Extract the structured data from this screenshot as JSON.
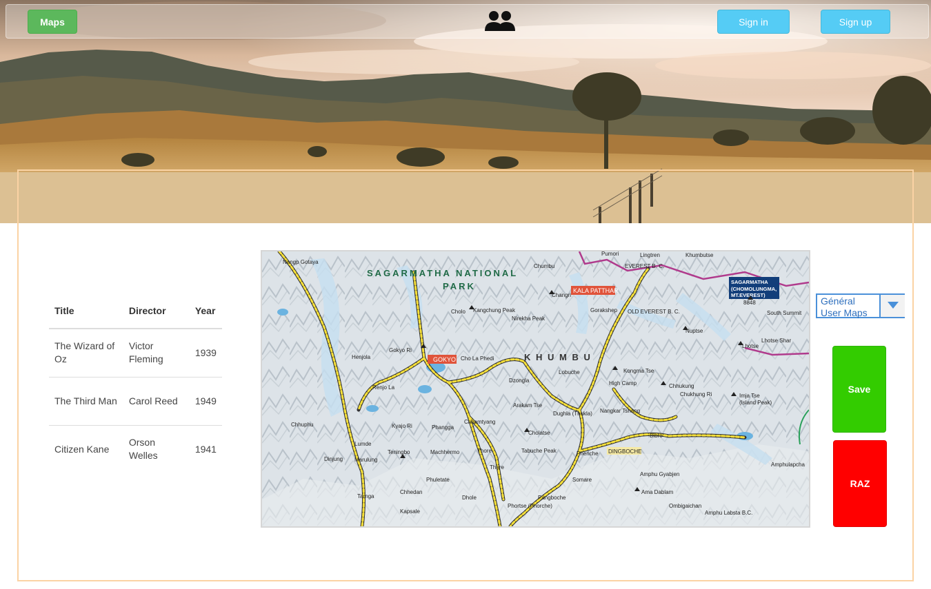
{
  "navbar": {
    "maps_label": "Maps",
    "users_icon": "users-icon",
    "signin_label": "Sign in",
    "signup_label": "Sign up",
    "maps_color": "#5cb85c",
    "auth_color": "#55ccf5"
  },
  "table": {
    "headers": [
      "Title",
      "Director",
      "Year"
    ],
    "rows": [
      {
        "title": "The Wizard of Oz",
        "director": "Victor Fleming",
        "year": "1939"
      },
      {
        "title": "The Third Man",
        "director": "Carol Reed",
        "year": "1949"
      },
      {
        "title": "Citizen Kane",
        "director": "Orson Welles",
        "year": "1941"
      }
    ]
  },
  "map": {
    "labels": {
      "park": "SAGARMATHA NATIONAL",
      "park2": "PARK",
      "khumbu": "K  H  U  M  B  U",
      "kala_patthar": "KALA PATTHAR",
      "gokyo": "GOKYO",
      "everest": "SAGARMATHA",
      "everest2": "(CHOMOLUNGMA,",
      "everest3": "MT.EVEREST)",
      "everest_h": "8848",
      "everest_bc": "EVEREST B. C.",
      "old_everest_bc": "OLD EVEREST B. C.",
      "gorakshep": "Gorakshep",
      "lobuche": "Lobuche",
      "dingboche": "DINGBOCHE",
      "pheriche": "Pheriche",
      "dughla": "Dughla (Thukla)",
      "dzongla": "Dzongla",
      "chhamtyang": "Chhamtyang",
      "phangga": "Phangga",
      "machhermo": "Machhermo",
      "thore": "Thore",
      "thare": "Thare",
      "dhole": "Dhole",
      "phortse": "Phortse (Phorche)",
      "pangboche": "Pangboche",
      "somare": "Somare",
      "marulung": "Marulung",
      "lumde": "Lumde",
      "tarnga": "Tarnga",
      "nangpa": "Nangp Gotaya",
      "khumbutse": "Khumbutse",
      "pumori": "Pumori",
      "nuptse": "Nuptse",
      "lhotse": "Lhotse",
      "lhotse_shar": "Lhotse Shar",
      "south_summit": "South Summit",
      "chhukung": "Chhukung",
      "ama_dablam": "Ama Dablam",
      "amphu_gyabjen": "Amphu Gyabjen",
      "imja_tse": "Imja Tse",
      "imja_tse2": "(Island Peak)",
      "cho_la": "Cho La Phedi",
      "renjo_la": "Renjo La",
      "gokyo_ri": "Gokyo Ri",
      "cholo": "Cholo",
      "kangchung": "Kangchung Peak",
      "nirekha": "Nirekha Peak",
      "changri": "Changri",
      "chumbu": "Chumbu",
      "lingtren": "Lingtren",
      "kongma_tse": "Kongma Tse",
      "cholatse": "Cholatse",
      "tabuche": "Tabuche Peak",
      "arakam": "Arakam Tse",
      "kyajo": "Kyajo Ri",
      "teningbo": "Teningbo",
      "phuletate": "Phuletate",
      "chhedan": "Chhedan",
      "kapsale": "Kapsale",
      "dinjung": "Dinjung",
      "chhuphu": "Chhuphu",
      "henjola": "Henjola",
      "high_camp": "High Camp",
      "nangkar": "Nangkar Tshang",
      "bibre": "Bibre",
      "amphu_labsta": "Amphu Labsta B.C.",
      "ombigaichan": "Ombigaichan",
      "amphulapcha": "Amphulapcha",
      "chukhung_ri": "Chukhung Ri"
    }
  },
  "select": {
    "options": [
      "Général",
      "User Maps"
    ],
    "accent": "#4a90d9"
  },
  "actions": {
    "save_label": "Save",
    "raz_label": "RAZ",
    "save_color": "#33cc00",
    "raz_color": "#ff0000"
  }
}
